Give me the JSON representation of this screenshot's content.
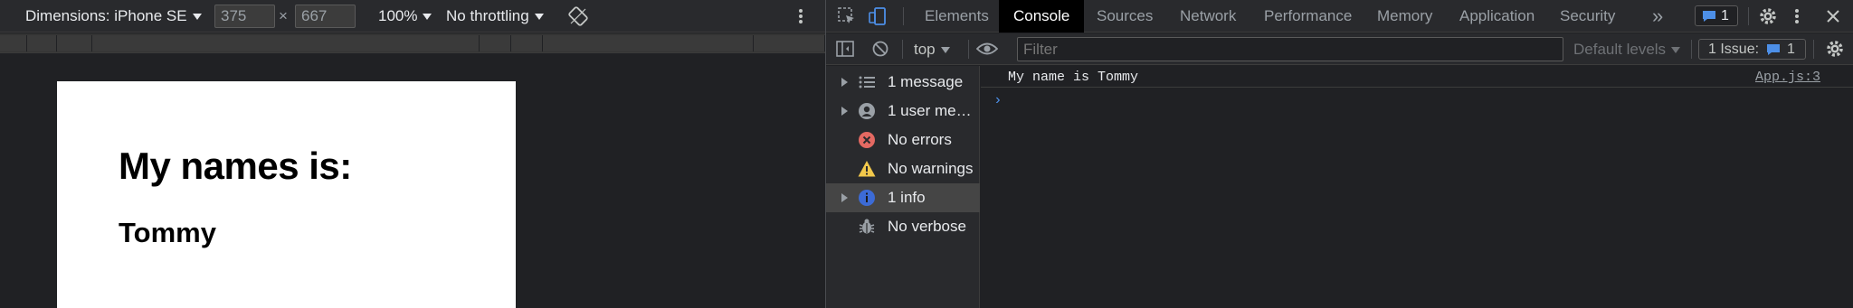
{
  "device_toolbar": {
    "dimensions_label": "Dimensions: iPhone SE",
    "width_value": "375",
    "times": "×",
    "height_value": "667",
    "zoom": "100%",
    "throttling": "No throttling"
  },
  "page": {
    "heading": "My names is:",
    "name": "Tommy"
  },
  "devtools": {
    "tabs": [
      "Elements",
      "Console",
      "Sources",
      "Network",
      "Performance",
      "Memory",
      "Application",
      "Security"
    ],
    "active_tab": "Console",
    "more_tabs": "»",
    "messages_badge_count": "1",
    "colors": {
      "accent": "#4d8fe7",
      "error": "#e46962",
      "warning": "#f2c84b",
      "info": "#3c6bd6"
    }
  },
  "console_toolbar": {
    "context": "top",
    "filter_placeholder": "Filter",
    "levels": "Default levels",
    "issues_label": "1 Issue:",
    "issues_count": "1"
  },
  "sidebar": {
    "items": [
      {
        "label": "1 message",
        "icon": "list-icon",
        "expandable": true
      },
      {
        "label": "1 user mes…",
        "icon": "user-icon",
        "expandable": true
      },
      {
        "label": "No errors",
        "icon": "error-icon",
        "expandable": false
      },
      {
        "label": "No warnings",
        "icon": "warning-icon",
        "expandable": false
      },
      {
        "label": "1 info",
        "icon": "info-icon",
        "expandable": true,
        "selected": true
      },
      {
        "label": "No verbose",
        "icon": "bug-icon",
        "expandable": false
      }
    ]
  },
  "console": {
    "message": "My name is Tommy",
    "source": "App.js:3",
    "prompt": "›"
  }
}
